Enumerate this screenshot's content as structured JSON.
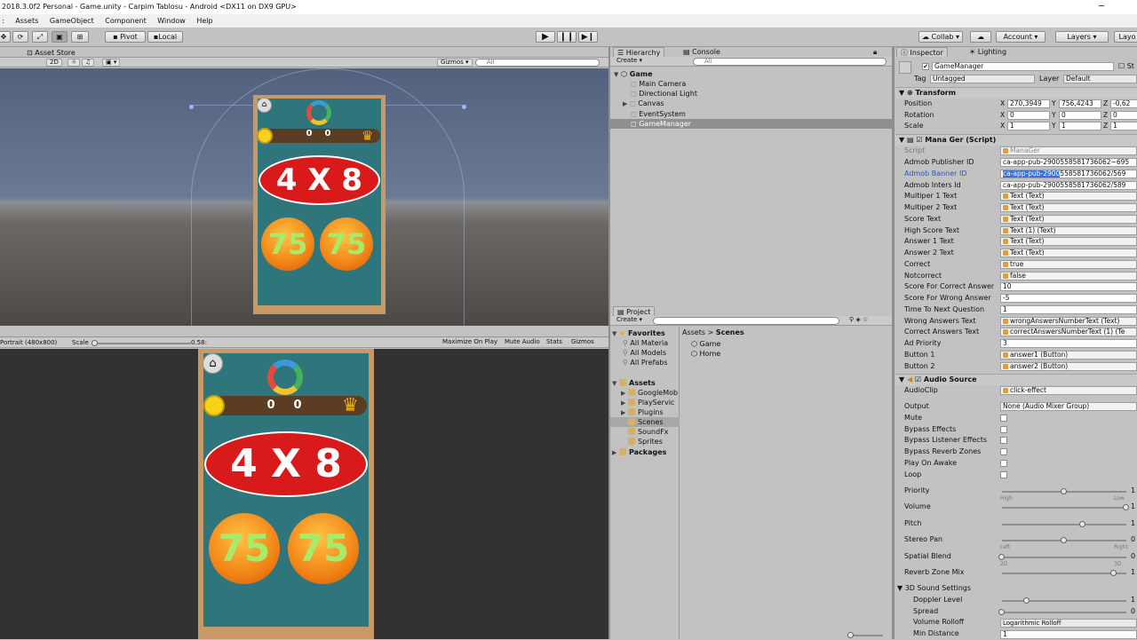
{
  "window": {
    "title": "2018.3.0f2 Personal - Game.unity - Carpim Tablosu - Android <DX11 on DX9 GPU>"
  },
  "menu": [
    "Assets",
    "GameObject",
    "Component",
    "Window",
    "Help"
  ],
  "toolbar": {
    "pivot": "Pivot",
    "local": "Local",
    "collab": "Collab",
    "account": "Account",
    "layers": "Layers",
    "layout": "Layo"
  },
  "scene": {
    "tab": "Asset Store",
    "mode2d": "2D",
    "gizmos": "Gizmos",
    "search": "All"
  },
  "game": {
    "aspect": "Portrait (480x800)",
    "scale_label": "Scale",
    "scale_value": "0.58:",
    "maximize": "Maximize On Play",
    "mute": "Mute Audio",
    "stats": "Stats",
    "gizmos": "Gizmos"
  },
  "phone": {
    "score_left": "0",
    "score_right": "0",
    "question": "4 X 8",
    "answer1": "75",
    "answer2": "75"
  },
  "hierarchy": {
    "tab": "Hierarchy",
    "console_tab": "Console",
    "create": "Create",
    "search": "All",
    "scene": "Game",
    "items": [
      "Main Camera",
      "Directional Light",
      "Canvas",
      "EventSystem",
      "GameManager"
    ]
  },
  "project": {
    "tab": "Project",
    "create": "Create",
    "favorites": "Favorites",
    "fav_items": [
      "All Materia",
      "All Models",
      "All Prefabs"
    ],
    "assets": "Assets",
    "asset_folders": [
      "GoogleMob",
      "PlayServic",
      "Plugins",
      "Scenes",
      "SoundFx",
      "Sprites"
    ],
    "packages": "Packages",
    "breadcrumb": [
      "Assets",
      "Scenes"
    ],
    "files": [
      "Game",
      "Home"
    ]
  },
  "inspector": {
    "tab": "Inspector",
    "lighting_tab": "Lighting",
    "object_name": "GameManager",
    "static": "St",
    "tag_label": "Tag",
    "tag": "Untagged",
    "layer_label": "Layer",
    "layer": "Default",
    "transform": {
      "title": "Transform",
      "rows": [
        {
          "label": "Position",
          "x": "270,3949",
          "y": "756,4243",
          "z": "-0,62"
        },
        {
          "label": "Rotation",
          "x": "0",
          "y": "0",
          "z": "0"
        },
        {
          "label": "Scale",
          "x": "1",
          "y": "1",
          "z": "1"
        }
      ]
    },
    "script": {
      "title": "Mana Ger (Script)",
      "script_label": "Script",
      "script_value": "ManaGer",
      "fields": [
        {
          "label": "Admob Publisher ID",
          "value": "ca-app-pub-2900558581736062~695",
          "kind": "text"
        },
        {
          "label": "Admob Banner ID",
          "value": "ca-app-pub-2900558581736062/569",
          "kind": "text",
          "highlight": "ca-app-pub-2900"
        },
        {
          "label": "Admob Inters Id",
          "value": "ca-app-pub-2900558581736062/589",
          "kind": "text"
        },
        {
          "label": "Multiper 1 Text",
          "value": "Text (Text)",
          "kind": "obj"
        },
        {
          "label": "Multiper 2 Text",
          "value": "Text (Text)",
          "kind": "obj"
        },
        {
          "label": "Score Text",
          "value": "Text (Text)",
          "kind": "obj"
        },
        {
          "label": "High Score Text",
          "value": "Text (1) (Text)",
          "kind": "obj"
        },
        {
          "label": "Answer 1 Text",
          "value": "Text (Text)",
          "kind": "obj"
        },
        {
          "label": "Answer 2 Text",
          "value": "Text (Text)",
          "kind": "obj"
        },
        {
          "label": "Correct",
          "value": "true",
          "kind": "obj"
        },
        {
          "label": "Notcorrect",
          "value": "false",
          "kind": "obj"
        },
        {
          "label": "Score For Correct Answer",
          "value": "10",
          "kind": "text"
        },
        {
          "label": "Score For Wrong Answer",
          "value": "-5",
          "kind": "text"
        },
        {
          "label": "Time To Next Question",
          "value": "1",
          "kind": "text"
        },
        {
          "label": "Wrong Answers Text",
          "value": "wrongAnswersNumberText (Text)",
          "kind": "obj"
        },
        {
          "label": "Correct Answers Text",
          "value": "correctAnswersNumberText (1) (Te",
          "kind": "obj"
        },
        {
          "label": "Ad Priority",
          "value": "3",
          "kind": "text"
        },
        {
          "label": "Button 1",
          "value": "answer1 (Button)",
          "kind": "obj"
        },
        {
          "label": "Button 2",
          "value": "answer2 (Button)",
          "kind": "obj"
        }
      ]
    },
    "audio": {
      "title": "Audio Source",
      "clip_label": "AudioClip",
      "clip": "click-effect",
      "output_label": "Output",
      "output": "None (Audio Mixer Group)",
      "checks": [
        "Mute",
        "Bypass Effects",
        "Bypass Listener Effects",
        "Bypass Reverb Zones",
        "Play On Awake",
        "Loop"
      ],
      "sliders": [
        {
          "label": "Priority",
          "value": 0.5,
          "readout": "1",
          "left": "High",
          "right": "Low"
        },
        {
          "label": "Volume",
          "value": 1.0,
          "readout": "1"
        },
        {
          "label": "Pitch",
          "value": 0.65,
          "readout": "1"
        },
        {
          "label": "Stereo Pan",
          "value": 0.5,
          "readout": "0",
          "left": "Left",
          "right": "Right"
        },
        {
          "label": "Spatial Blend",
          "value": 0.0,
          "readout": "0",
          "left": "2D",
          "right": "3D"
        },
        {
          "label": "Reverb Zone Mix",
          "value": 0.9,
          "readout": "1"
        }
      ],
      "sound3d": "3D Sound Settings",
      "sound3d_rows": [
        {
          "label": "Doppler Level",
          "value": 0.2,
          "readout": "1"
        },
        {
          "label": "Spread",
          "value": 0.0,
          "readout": "0"
        }
      ],
      "rolloff_label": "Volume Rolloff",
      "rolloff": "Logarithmic Rolloff",
      "mindist_label": "Min Distance",
      "mindist": "1"
    }
  }
}
